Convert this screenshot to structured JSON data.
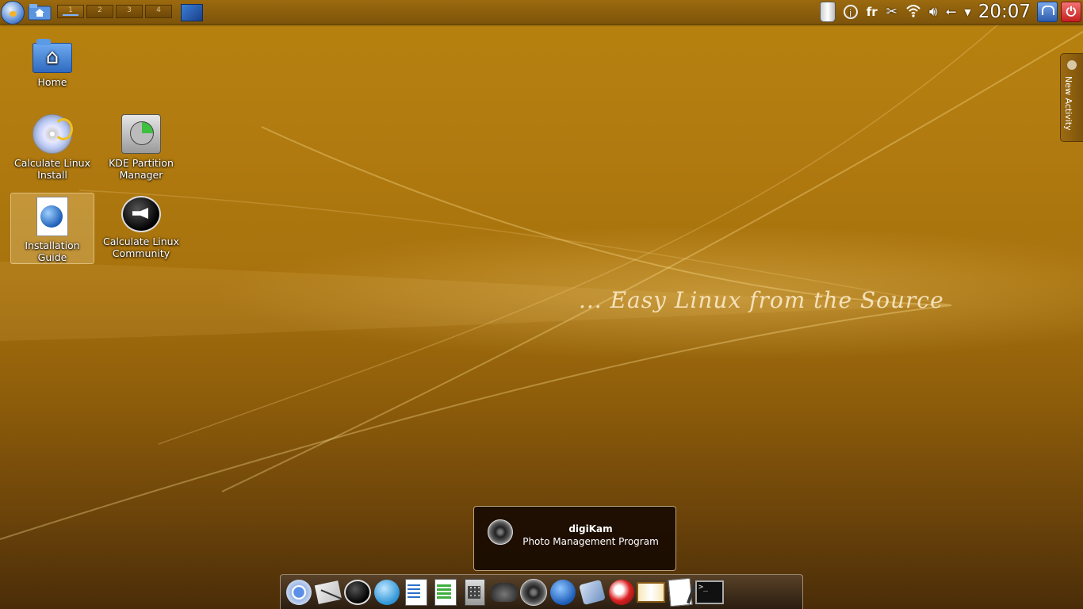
{
  "top_panel": {
    "pager": [
      "1",
      "2",
      "3",
      "4"
    ],
    "keyboard_layout": "fr",
    "clock": "20:07"
  },
  "desktop": {
    "icons": [
      {
        "label": "Home",
        "icon": "home-folder-icon"
      },
      {
        "label": "Calculate Linux Install",
        "icon": "install-disc-icon"
      },
      {
        "label": "KDE Partition Manager",
        "icon": "hard-disk-icon"
      },
      {
        "label": "Installation Guide",
        "icon": "web-document-icon"
      },
      {
        "label": "Calculate Linux Community",
        "icon": "megaphone-bubble-icon"
      }
    ],
    "slogan": "... Easy Linux from the Source",
    "activity_tab": "New Activity"
  },
  "tooltip": {
    "title": "digiKam",
    "description": "Photo Management Program"
  },
  "dock": {
    "items": [
      "chromium-icon",
      "mail-icon",
      "megaphone-icon",
      "chat-icon",
      "writer-icon",
      "spreadsheet-icon",
      "calculator-icon",
      "gimp-icon",
      "digikam-icon",
      "wolf-icon",
      "video-editor-icon",
      "rocket-icon",
      "book-icon",
      "text-editor-icon",
      "terminal-icon"
    ],
    "terminal_prompt": ">_"
  },
  "colors": {
    "accent": "#b07a10",
    "panel": "#8a5c0d",
    "tooltip_bg": "#190c02"
  }
}
